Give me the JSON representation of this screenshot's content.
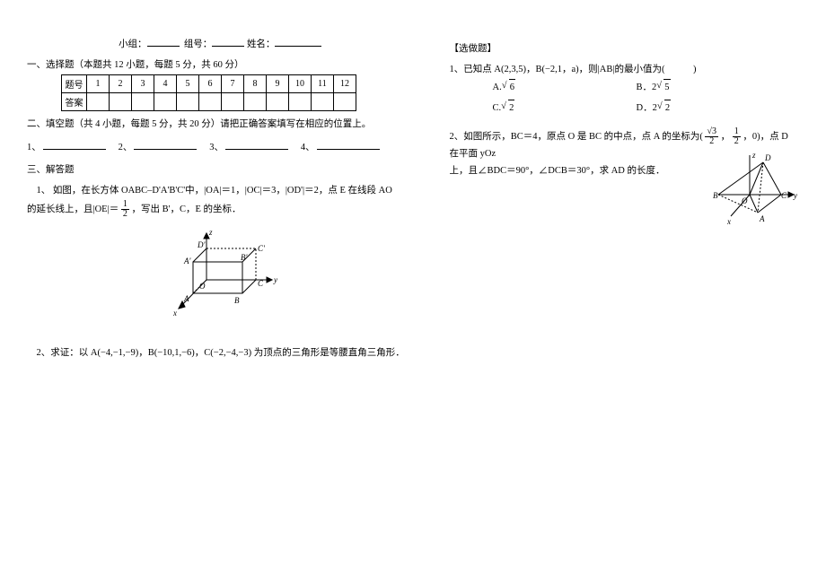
{
  "header": {
    "group_label": "小组：",
    "groupno_label": "组号：",
    "name_label": "姓名："
  },
  "section1": {
    "title": "一、选择题（本题共 12 小题，每题 5 分，共 60 分）",
    "row1_label": "题号",
    "row2_label": "答案",
    "cols": [
      "1",
      "2",
      "3",
      "4",
      "5",
      "6",
      "7",
      "8",
      "9",
      "10",
      "11",
      "12"
    ]
  },
  "section2": {
    "title": "二、填空题（共 4 小题，每题 5 分，共 20 分）请把正确答案填写在相应的位置上。",
    "items": [
      "1、",
      "2、",
      "3、",
      "4、"
    ]
  },
  "section3": {
    "title": "三、解答题",
    "q1_a": "1、 如图，在长方体 OABC–D'A'B'C'中，|OA|＝1，|OC|＝3，|OD'|＝2，点 E 在线段 AO",
    "q1_b": "的延长线上，且|OE|＝",
    "q1_c": "，写出 B'，C，E 的坐标．",
    "q2": "2、求证：以 A(−4,−1,−9)，B(−10,1,−6)，C(−2,−4,−3) 为顶点的三角形是等腰直角三角形．"
  },
  "optional": {
    "heading": "【选做题】",
    "q1_a": "1、已知点 A(2,3,5)，B(−2,1，a)，则|AB|的最小值为(　　　)",
    "q1_opts": {
      "A": "A.",
      "Av": "6",
      "B": "B．2",
      "Bv": "5",
      "C": "C.",
      "Cv": "2",
      "D": "D．2",
      "Dv": "2"
    },
    "q2_a": "2、如图所示，BC＝4，原点 O 是 BC 的中点，点 A 的坐标为(",
    "q2_b": "，",
    "q2_c": "，0)，点 D 在平面 yOz",
    "q2_d": "上，且∠BDC＝90°，∠DCB＝30°，求 AD 的长度．",
    "frac1_n": "√3",
    "frac1_d": "2",
    "frac2_n": "1",
    "frac2_d": "2"
  },
  "figure1_labels": {
    "z": "z",
    "y": "y",
    "x": "x",
    "O": "O",
    "A": "A",
    "B": "B",
    "C": "C",
    "Dp": "D'",
    "Ap": "A'",
    "Bp": "B'",
    "Cp": "C'"
  },
  "figure2_labels": {
    "z": "z",
    "y": "y",
    "x": "x",
    "O": "O",
    "A": "A",
    "B": "B",
    "C": "C",
    "D": "D"
  }
}
